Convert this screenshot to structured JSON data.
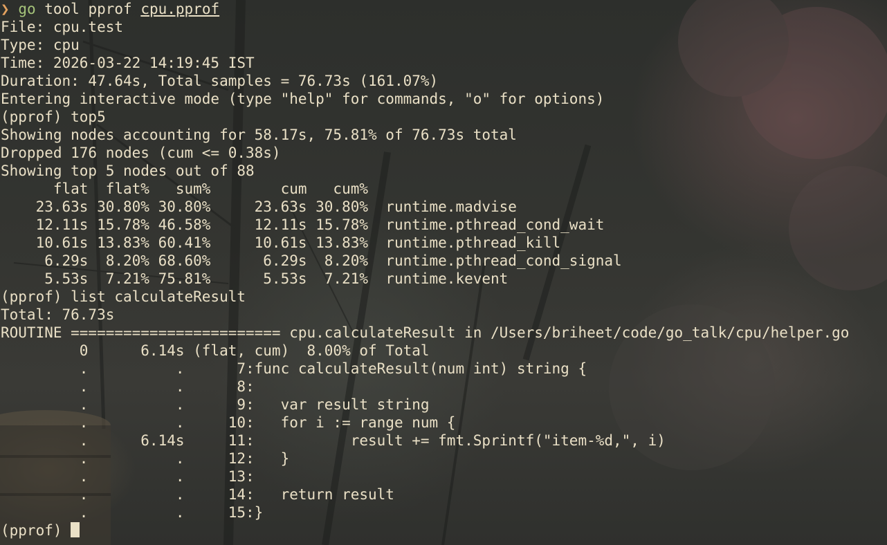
{
  "prompt": {
    "arrow": "❯",
    "program": "go",
    "args": " tool pprof ",
    "file": "cpu.pprof"
  },
  "output": [
    "File: cpu.test",
    "Type: cpu",
    "Time: 2026-03-22 14:19:45 IST",
    "Duration: 47.64s, Total samples = 76.73s (161.07%)",
    "Entering interactive mode (type \"help\" for commands, \"o\" for options)",
    "(pprof) top5",
    "Showing nodes accounting for 58.17s, 75.81% of 76.73s total",
    "Dropped 176 nodes (cum <= 0.38s)",
    "Showing top 5 nodes out of 88",
    "      flat  flat%   sum%        cum   cum%",
    "    23.63s 30.80% 30.80%     23.63s 30.80%  runtime.madvise",
    "    12.11s 15.78% 46.58%     12.11s 15.78%  runtime.pthread_cond_wait",
    "    10.61s 13.83% 60.41%     10.61s 13.83%  runtime.pthread_kill",
    "     6.29s  8.20% 68.60%      6.29s  8.20%  runtime.pthread_cond_signal",
    "     5.53s  7.21% 75.81%      5.53s  7.21%  runtime.kevent",
    "(pprof) list calculateResult",
    "Total: 76.73s",
    "ROUTINE ======================== cpu.calculateResult in /Users/briheet/code/go_talk/cpu/helper.go",
    "         0      6.14s (flat, cum)  8.00% of Total",
    "         .          .      7:func calculateResult(num int) string {",
    "         .          .      8:",
    "         .          .      9:   var result string",
    "         .          .     10:   for i := range num {",
    "         .      6.14s     11:           result += fmt.Sprintf(\"item-%d,\", i)",
    "         .          .     12:   }",
    "         .          .     13:",
    "         .          .     14:   return result",
    "         .          .     15:}"
  ],
  "input_line": {
    "prompt": "(pprof) ",
    "value": ""
  }
}
